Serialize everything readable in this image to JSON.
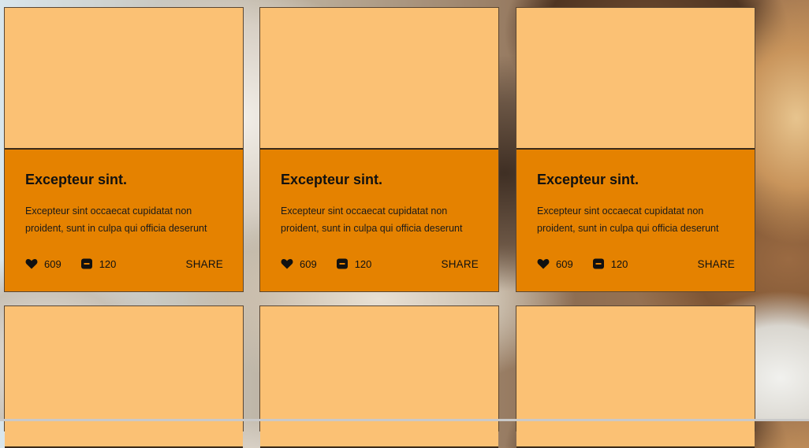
{
  "cards": [
    {
      "title": "Excepteur sint.",
      "text": "Excepteur sint occaecat cupidatat non proident, sunt in culpa qui officia deserunt",
      "likes": "609",
      "comments": "120",
      "share": "SHARE"
    },
    {
      "title": "Excepteur sint.",
      "text": "Excepteur sint occaecat cupidatat non proident, sunt in culpa qui officia deserunt",
      "likes": "609",
      "comments": "120",
      "share": "SHARE"
    },
    {
      "title": "Excepteur sint.",
      "text": "Excepteur sint occaecat cupidatat non proident, sunt in culpa qui officia deserunt",
      "likes": "609",
      "comments": "120",
      "share": "SHARE"
    }
  ],
  "colors": {
    "card_media": "#fbc174",
    "card_body": "#e58200"
  },
  "icons": {
    "like": "heart-icon",
    "comment": "comment-icon"
  }
}
